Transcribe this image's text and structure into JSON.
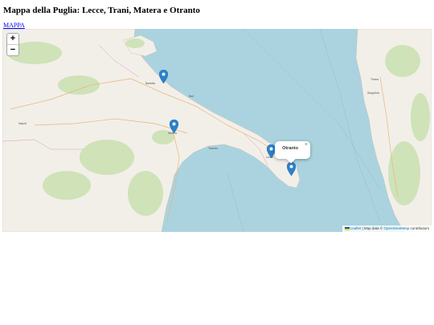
{
  "page": {
    "title": "Mappa della Puglia: Lecce, Trani, Matera e Otranto",
    "link_label": "MAPPA"
  },
  "map": {
    "zoom_in_label": "+",
    "zoom_out_label": "−",
    "popup_text": "Otranto",
    "popup_close": "×",
    "attribution": {
      "leaflet": "Leaflet",
      "separator": " | Map data © ",
      "osm": "OpenStreetMap",
      "contributors": " contributors"
    },
    "marker_color": "#2a81cb",
    "sea_color": "#aad3df",
    "land_color": "#f2efe9",
    "place_labels": [
      "Barletta",
      "Matera",
      "Lecce",
      "Napoli",
      "Taranto",
      "Bari",
      "Tirana",
      "Shqipëria"
    ]
  }
}
